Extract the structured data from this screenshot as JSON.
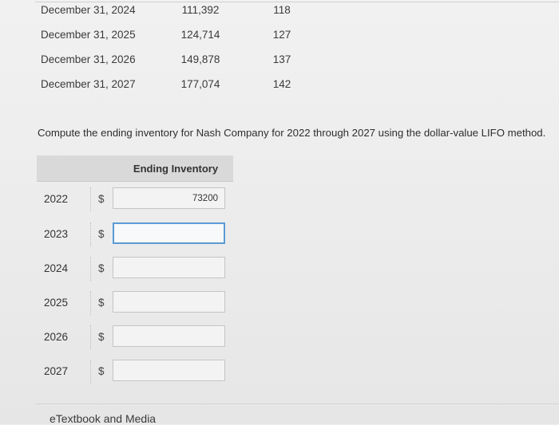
{
  "index_table": {
    "rows": [
      {
        "date": "December 31, 2024",
        "cost": "111,392",
        "index": "118"
      },
      {
        "date": "December 31, 2025",
        "cost": "124,714",
        "index": "127"
      },
      {
        "date": "December 31, 2026",
        "cost": "149,878",
        "index": "137"
      },
      {
        "date": "December 31, 2027",
        "cost": "177,074",
        "index": "142"
      }
    ]
  },
  "instruction": "Compute the ending inventory for Nash Company for 2022 through 2027 using the dollar-value LIFO method.",
  "inventory_table": {
    "header": "Ending Inventory",
    "currency": "$",
    "rows": [
      {
        "year": "2022",
        "value": "73200"
      },
      {
        "year": "2023",
        "value": ""
      },
      {
        "year": "2024",
        "value": ""
      },
      {
        "year": "2025",
        "value": ""
      },
      {
        "year": "2026",
        "value": ""
      },
      {
        "year": "2027",
        "value": ""
      }
    ]
  },
  "footer": {
    "link": "eTextbook and Media"
  }
}
